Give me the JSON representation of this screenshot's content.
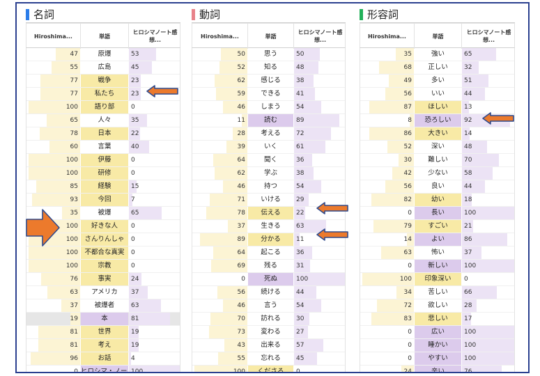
{
  "panels": [
    {
      "key": "noun",
      "title": "名詞",
      "accent": "#2b7de9",
      "headers": [
        "Hiroshima...",
        "単語",
        "ヒロシマノート感想..."
      ],
      "rows": [
        {
          "count": 47,
          "word": "原爆",
          "pct": 53,
          "hl": ""
        },
        {
          "count": 55,
          "word": "広島",
          "pct": 45,
          "hl": ""
        },
        {
          "count": 77,
          "word": "戦争",
          "pct": 23,
          "hl": "y"
        },
        {
          "count": 77,
          "word": "私たち",
          "pct": 23,
          "hl": "y"
        },
        {
          "count": 100,
          "word": "語り部",
          "pct": 0,
          "hl": "y"
        },
        {
          "count": 65,
          "word": "人々",
          "pct": 35,
          "hl": ""
        },
        {
          "count": 78,
          "word": "日本",
          "pct": 22,
          "hl": "y"
        },
        {
          "count": 60,
          "word": "言葉",
          "pct": 40,
          "hl": ""
        },
        {
          "count": 100,
          "word": "伊藤",
          "pct": 0,
          "hl": "y"
        },
        {
          "count": 100,
          "word": "研修",
          "pct": 0,
          "hl": "y"
        },
        {
          "count": 85,
          "word": "経験",
          "pct": 15,
          "hl": "y"
        },
        {
          "count": 93,
          "word": "今回",
          "pct": 7,
          "hl": "y"
        },
        {
          "count": 35,
          "word": "被爆",
          "pct": 65,
          "hl": ""
        },
        {
          "count": 100,
          "word": "好きな人",
          "pct": 0,
          "hl": "y"
        },
        {
          "count": 100,
          "word": "さんりんしゃ",
          "pct": 0,
          "hl": "y"
        },
        {
          "count": 100,
          "word": "不都合な真実",
          "pct": 0,
          "hl": "y"
        },
        {
          "count": 100,
          "word": "宗教",
          "pct": 0,
          "hl": "y"
        },
        {
          "count": 76,
          "word": "事実",
          "pct": 24,
          "hl": "y"
        },
        {
          "count": 63,
          "word": "アメリカ",
          "pct": 37,
          "hl": ""
        },
        {
          "count": 37,
          "word": "被爆者",
          "pct": 63,
          "hl": ""
        },
        {
          "count": 19,
          "word": "本",
          "pct": 81,
          "hl": "p",
          "sel": true
        },
        {
          "count": 81,
          "word": "世界",
          "pct": 19,
          "hl": "y"
        },
        {
          "count": 81,
          "word": "考え",
          "pct": 19,
          "hl": "y"
        },
        {
          "count": 96,
          "word": "お話",
          "pct": 4,
          "hl": "y"
        },
        {
          "count": 0,
          "word": "ヒロシマ・ノート",
          "pct": 100,
          "hl": "p"
        }
      ]
    },
    {
      "key": "verb",
      "title": "動詞",
      "accent": "#e8838a",
      "headers": [
        "Hiroshima...",
        "単語",
        "ヒロシマノート感想..."
      ],
      "rows": [
        {
          "count": 50,
          "word": "思う",
          "pct": 50,
          "hl": ""
        },
        {
          "count": 52,
          "word": "知る",
          "pct": 48,
          "hl": ""
        },
        {
          "count": 62,
          "word": "感じる",
          "pct": 38,
          "hl": ""
        },
        {
          "count": 59,
          "word": "できる",
          "pct": 41,
          "hl": ""
        },
        {
          "count": 46,
          "word": "しまう",
          "pct": 54,
          "hl": ""
        },
        {
          "count": 11,
          "word": "読む",
          "pct": 89,
          "hl": "p"
        },
        {
          "count": 28,
          "word": "考える",
          "pct": 72,
          "hl": ""
        },
        {
          "count": 39,
          "word": "いく",
          "pct": 61,
          "hl": ""
        },
        {
          "count": 64,
          "word": "聞く",
          "pct": 36,
          "hl": ""
        },
        {
          "count": 62,
          "word": "学ぶ",
          "pct": 38,
          "hl": ""
        },
        {
          "count": 46,
          "word": "持つ",
          "pct": 54,
          "hl": ""
        },
        {
          "count": 71,
          "word": "いける",
          "pct": 29,
          "hl": ""
        },
        {
          "count": 78,
          "word": "伝える",
          "pct": 22,
          "hl": "y"
        },
        {
          "count": 37,
          "word": "生きる",
          "pct": 63,
          "hl": ""
        },
        {
          "count": 89,
          "word": "分かる",
          "pct": 11,
          "hl": "y"
        },
        {
          "count": 64,
          "word": "起こる",
          "pct": 36,
          "hl": ""
        },
        {
          "count": 69,
          "word": "残る",
          "pct": 31,
          "hl": ""
        },
        {
          "count": 0,
          "word": "死ぬ",
          "pct": 100,
          "hl": "p"
        },
        {
          "count": 56,
          "word": "続ける",
          "pct": 44,
          "hl": ""
        },
        {
          "count": 46,
          "word": "言う",
          "pct": 54,
          "hl": ""
        },
        {
          "count": 70,
          "word": "訪れる",
          "pct": 30,
          "hl": ""
        },
        {
          "count": 73,
          "word": "変わる",
          "pct": 27,
          "hl": ""
        },
        {
          "count": 43,
          "word": "出来る",
          "pct": 57,
          "hl": ""
        },
        {
          "count": 55,
          "word": "忘れる",
          "pct": 45,
          "hl": ""
        },
        {
          "count": 100,
          "word": "くださる",
          "pct": 0,
          "hl": "y"
        }
      ]
    },
    {
      "key": "adjective",
      "title": "形容詞",
      "accent": "#22b15a",
      "headers": [
        "Hiroshima...",
        "単語",
        "ヒロシマノート感想..."
      ],
      "rows": [
        {
          "count": 35,
          "word": "強い",
          "pct": 65,
          "hl": ""
        },
        {
          "count": 68,
          "word": "正しい",
          "pct": 32,
          "hl": ""
        },
        {
          "count": 49,
          "word": "多い",
          "pct": 51,
          "hl": ""
        },
        {
          "count": 56,
          "word": "いい",
          "pct": 44,
          "hl": ""
        },
        {
          "count": 87,
          "word": "ほしい",
          "pct": 13,
          "hl": "y"
        },
        {
          "count": 8,
          "word": "恐ろしい",
          "pct": 92,
          "hl": "p"
        },
        {
          "count": 86,
          "word": "大きい",
          "pct": 14,
          "hl": "y"
        },
        {
          "count": 52,
          "word": "深い",
          "pct": 48,
          "hl": ""
        },
        {
          "count": 30,
          "word": "難しい",
          "pct": 70,
          "hl": ""
        },
        {
          "count": 42,
          "word": "少ない",
          "pct": 58,
          "hl": ""
        },
        {
          "count": 56,
          "word": "良い",
          "pct": 44,
          "hl": ""
        },
        {
          "count": 82,
          "word": "幼い",
          "pct": 18,
          "hl": "y"
        },
        {
          "count": 0,
          "word": "長い",
          "pct": 100,
          "hl": "p"
        },
        {
          "count": 79,
          "word": "すごい",
          "pct": 21,
          "hl": "y"
        },
        {
          "count": 14,
          "word": "よい",
          "pct": 86,
          "hl": "p"
        },
        {
          "count": 63,
          "word": "怖い",
          "pct": 37,
          "hl": ""
        },
        {
          "count": 0,
          "word": "新しい",
          "pct": 100,
          "hl": "p"
        },
        {
          "count": 100,
          "word": "印象深い",
          "pct": 0,
          "hl": "y"
        },
        {
          "count": 34,
          "word": "苦しい",
          "pct": 66,
          "hl": ""
        },
        {
          "count": 72,
          "word": "欲しい",
          "pct": 28,
          "hl": ""
        },
        {
          "count": 83,
          "word": "悲しい",
          "pct": 17,
          "hl": "y"
        },
        {
          "count": 0,
          "word": "広い",
          "pct": 100,
          "hl": "p"
        },
        {
          "count": 0,
          "word": "睡かい",
          "pct": 100,
          "hl": "p"
        },
        {
          "count": 0,
          "word": "やすい",
          "pct": 100,
          "hl": "p"
        },
        {
          "count": 24,
          "word": "辛い",
          "pct": 76,
          "hl": "p"
        }
      ]
    }
  ],
  "colors": {
    "frame": "#2a3f8f",
    "arrow_fill": "#ec7a2c",
    "arrow_stroke": "#2f4a8c"
  }
}
